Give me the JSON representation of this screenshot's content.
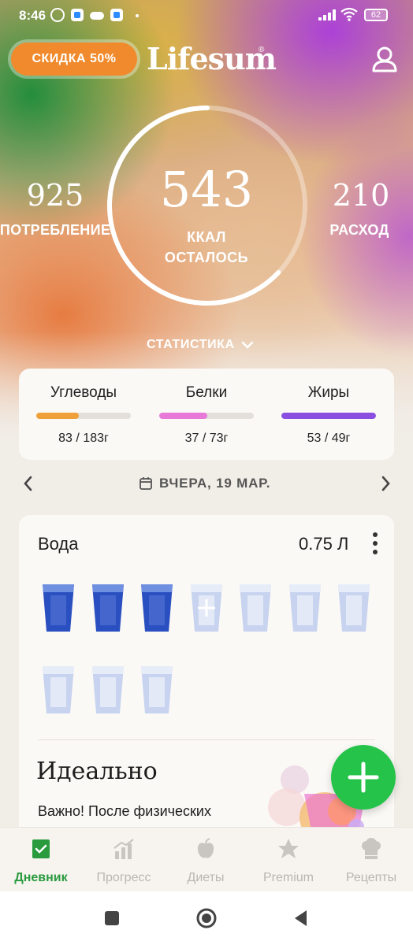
{
  "status_bar": {
    "time": "8:46",
    "battery": "62"
  },
  "header": {
    "discount_label": "СКИДКА 50%",
    "logo": "Lifesum",
    "logo_mark": "®"
  },
  "calories": {
    "intake_value": "925",
    "intake_label": "ПОТРЕБЛЕНИЕ",
    "remaining_value": "543",
    "remaining_unit": "ККАЛ",
    "remaining_label": "ОСТАЛОСЬ",
    "burned_value": "210",
    "burned_label": "РАСХОД",
    "ring_progress": 0.63,
    "stats_label": "СТАТИСТИКА"
  },
  "macros": [
    {
      "name": "Углеводы",
      "value": "83 / 183г",
      "progress": 0.45,
      "color": "#f0a03a"
    },
    {
      "name": "Белки",
      "value": "37 / 73г",
      "progress": 0.51,
      "color": "#e879d9"
    },
    {
      "name": "Жиры",
      "value": "53 / 49г",
      "progress": 1.0,
      "color": "#8a4fe0"
    }
  ],
  "date_nav": {
    "label": "ВЧЕРА, 19 МАР."
  },
  "water": {
    "title": "Вода",
    "amount": "0.75 Л",
    "filled_glasses": 3,
    "total_glasses": 10
  },
  "tip": {
    "title": "Идеально",
    "text": "Важно! После физических"
  },
  "bottom_nav": [
    {
      "label": "Дневник",
      "icon": "diary-icon",
      "active": true
    },
    {
      "label": "Прогресс",
      "icon": "progress-chart-icon",
      "active": false
    },
    {
      "label": "Диеты",
      "icon": "apple-icon",
      "active": false
    },
    {
      "label": "Premium",
      "icon": "star-icon",
      "active": false
    },
    {
      "label": "Рецепты",
      "icon": "chef-hat-icon",
      "active": false
    }
  ],
  "colors": {
    "accent_green": "#26c34a",
    "discount_orange": "#f08a2c",
    "water_blue": "#2a4fc0"
  }
}
